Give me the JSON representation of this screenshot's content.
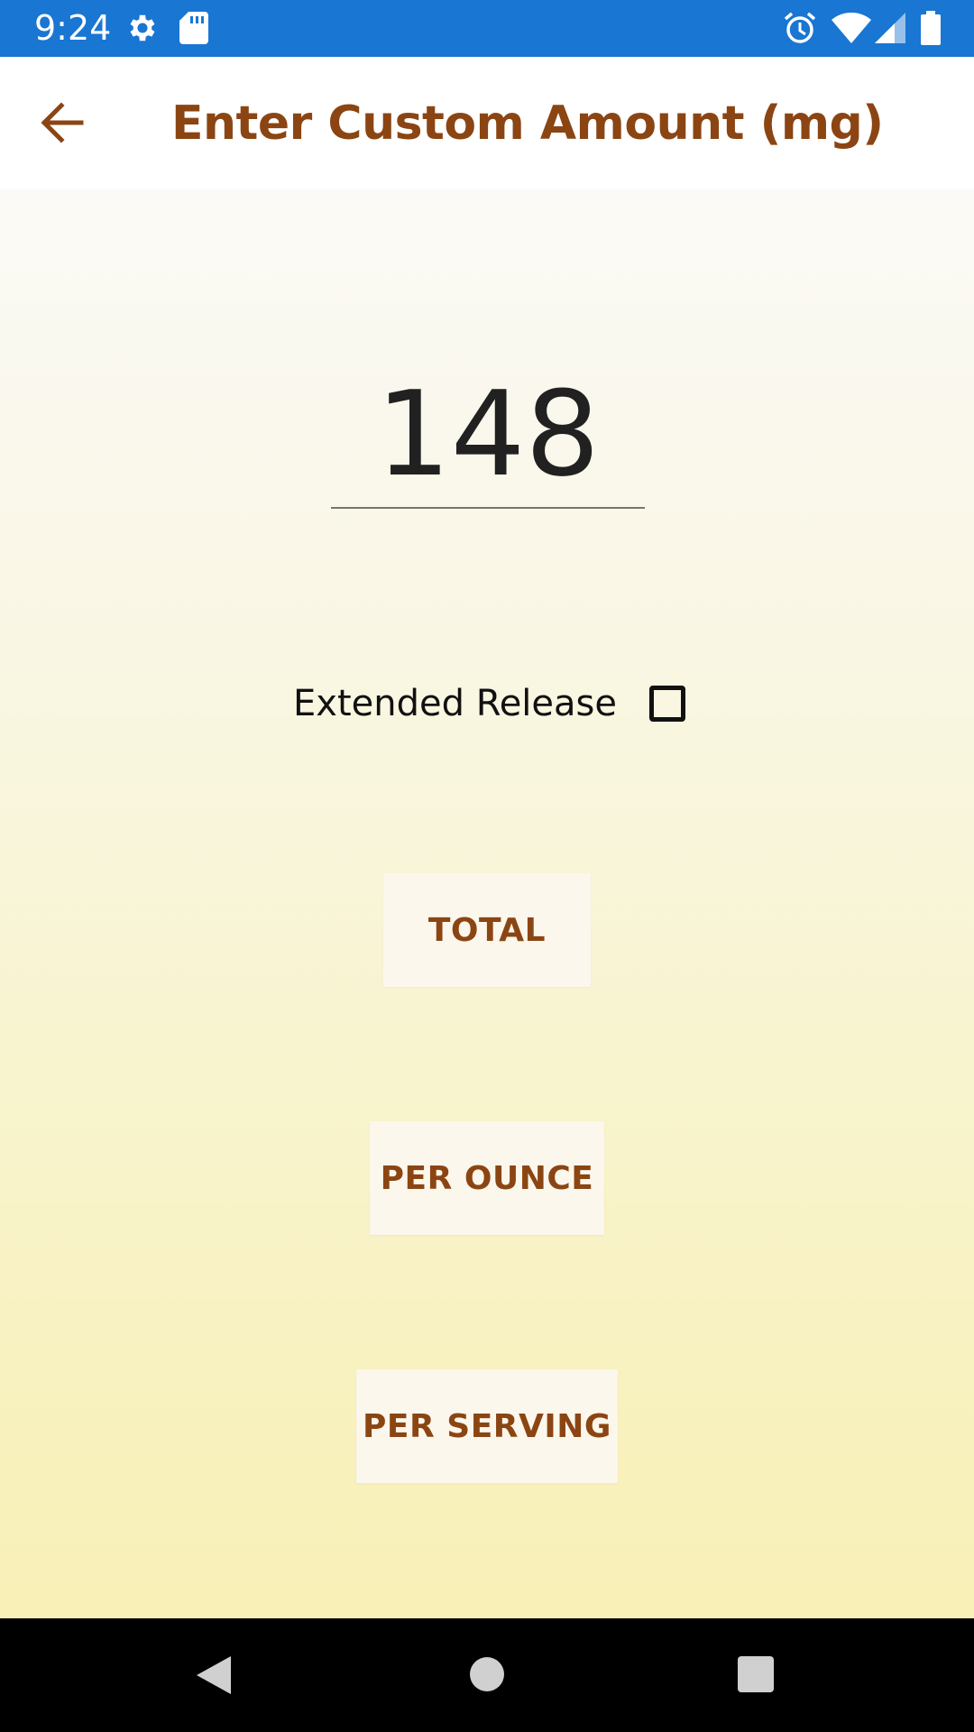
{
  "status_bar": {
    "time": "9:24",
    "left_icons": [
      "settings-icon",
      "sd-card-icon"
    ],
    "right_icons": [
      "alarm-icon",
      "wifi-icon",
      "signal-icon",
      "battery-icon"
    ],
    "background": "#1976D2"
  },
  "app_bar": {
    "title": "Enter Custom Amount (mg)",
    "back_icon": "back-arrow-icon",
    "title_color": "#8B4513"
  },
  "form": {
    "amount_value": "148",
    "extended_release_label": "Extended Release",
    "extended_release_checked": false
  },
  "buttons": {
    "total": "TOTAL",
    "per_ounce": "PER OUNCE",
    "per_serving": "PER SERVING"
  },
  "nav_bar": {
    "icons": [
      "back-triangle-icon",
      "home-circle-icon",
      "recents-square-icon"
    ]
  }
}
